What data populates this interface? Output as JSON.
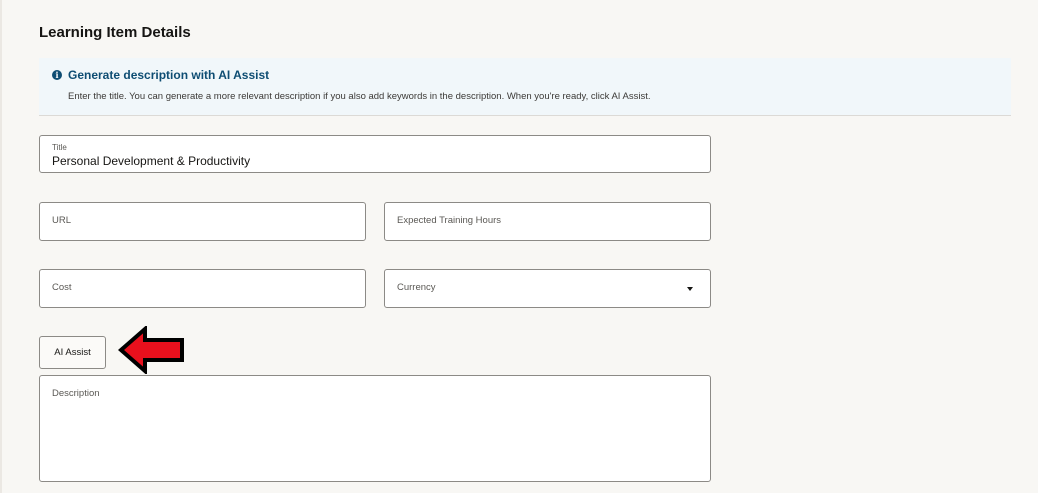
{
  "section": {
    "title": "Learning Item Details"
  },
  "info_banner": {
    "icon": "info-icon",
    "title": "Generate description with AI Assist",
    "text": "Enter the title. You can generate a more relevant description if you also add keywords in the description. When you're ready, click AI Assist."
  },
  "form": {
    "title": {
      "label": "Title",
      "value": "Personal Development & Productivity"
    },
    "url": {
      "label": "URL",
      "value": ""
    },
    "expected_hours": {
      "label": "Expected Training Hours",
      "value": ""
    },
    "cost": {
      "label": "Cost",
      "value": ""
    },
    "currency": {
      "label": "Currency",
      "value": "",
      "icon": "chevron-down-icon"
    },
    "ai_assist_label": "AI Assist",
    "description": {
      "label": "Description",
      "value": ""
    }
  },
  "annotation": {
    "icon": "pointer-arrow-icon",
    "fill_color": "#e8101d",
    "stroke_color": "#000000"
  },
  "colors": {
    "page_background": "#f8f7f4",
    "banner_background": "#f1f7fa",
    "banner_accent": "#0e4d73",
    "field_border": "#8c8a86"
  }
}
